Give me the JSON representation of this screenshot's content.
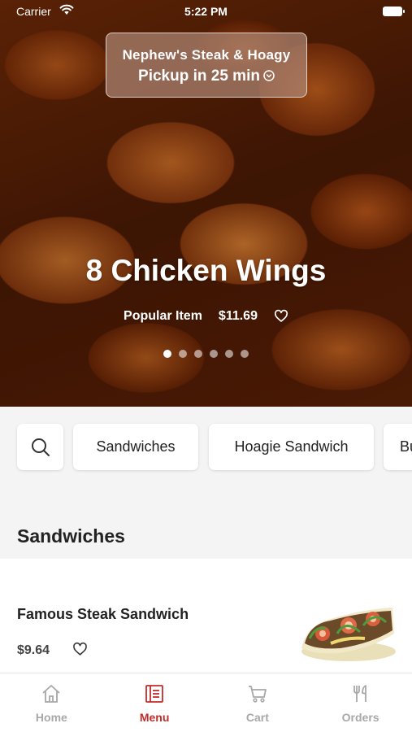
{
  "status_bar": {
    "carrier": "Carrier",
    "time": "5:22 PM"
  },
  "pickup": {
    "store": "Nephew's Steak & Hoagy",
    "time": "Pickup in 25 min"
  },
  "featured": {
    "title": "8 Chicken Wings",
    "badge": "Popular Item",
    "price": "$11.69",
    "carousel_total": 6,
    "carousel_active": 1
  },
  "categories": [
    "Sandwiches",
    "Hoagie Sandwich",
    "Bu"
  ],
  "section": {
    "title": "Sandwiches"
  },
  "item": {
    "name": "Famous Steak Sandwich",
    "price": "$9.64"
  },
  "tabs": [
    {
      "label": "Home",
      "icon": "home-icon"
    },
    {
      "label": "Menu",
      "icon": "menu-icon"
    },
    {
      "label": "Cart",
      "icon": "cart-icon"
    },
    {
      "label": "Orders",
      "icon": "utensils-icon"
    }
  ],
  "colors": {
    "accent": "#c42b2b",
    "inactive": "#a8a8a8"
  }
}
